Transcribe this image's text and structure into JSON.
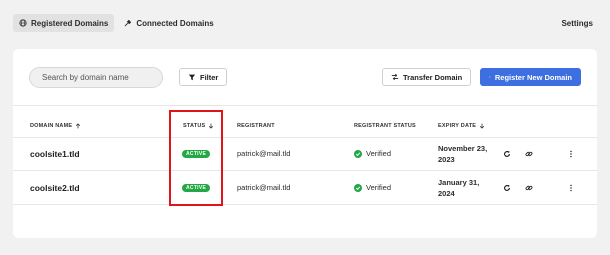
{
  "nav": {
    "tabs": [
      {
        "label": "Registered Domains",
        "icon": "globe-icon",
        "active": true
      },
      {
        "label": "Connected Domains",
        "icon": "plug-icon",
        "active": false
      }
    ],
    "settings_label": "Settings"
  },
  "toolbar": {
    "search_placeholder": "Search by domain name",
    "filter_label": "Filter",
    "transfer_label": "Transfer Domain",
    "register_label": "Register New Domain"
  },
  "table": {
    "columns": {
      "domain_name": "DOMAIN NAME",
      "status": "STATUS",
      "registrant": "REGISTRANT",
      "registrant_status": "REGISTRANT STATUS",
      "expiry_date": "EXPIRY DATE"
    },
    "rows": [
      {
        "domain": "coolsite1.tld",
        "status": "ACTIVE",
        "registrant": "patrick@mail.tld",
        "registrant_status": "Verified",
        "expiry_line1": "November 23,",
        "expiry_line2": "2023"
      },
      {
        "domain": "coolsite2.tld",
        "status": "ACTIVE",
        "registrant": "patrick@mail.tld",
        "registrant_status": "Verified",
        "expiry_line1": "January 31,",
        "expiry_line2": "2024"
      }
    ]
  },
  "colors": {
    "primary": "#3d6fe0",
    "active_badge": "#22a845",
    "highlight": "#e0141b"
  }
}
